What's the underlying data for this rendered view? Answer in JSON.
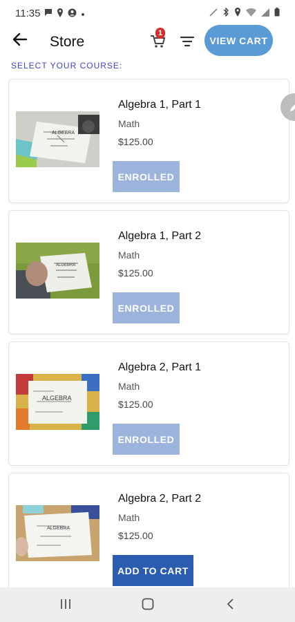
{
  "status_bar": {
    "time": "11:35",
    "left_icons": [
      "message-icon",
      "location-icon",
      "account-icon",
      "dot-icon"
    ],
    "right_icons": [
      "mute-icon",
      "bluetooth-icon",
      "location-icon",
      "wifi-icon",
      "signal-icon",
      "battery-icon"
    ]
  },
  "app_bar": {
    "title": "Store",
    "cart_badge": "1",
    "view_cart_label": "VIEW CART",
    "accent": "#5b9bd5"
  },
  "content": {
    "select_label": "SELECT YOUR COURSE:",
    "courses": [
      {
        "name": "Algebra 1, Part 1",
        "subject": "Math",
        "price": "$125.00",
        "button": "ENROLLED",
        "status": "enrolled"
      },
      {
        "name": "Algebra 1, Part 2",
        "subject": "Math",
        "price": "$125.00",
        "button": "ENROLLED",
        "status": "enrolled"
      },
      {
        "name": "Algebra 2, Part 1",
        "subject": "Math",
        "price": "$125.00",
        "button": "ENROLLED",
        "status": "enrolled"
      },
      {
        "name": "Algebra 2, Part 2",
        "subject": "Math",
        "price": "$125.00",
        "button": "ADD TO CART",
        "status": "available"
      }
    ]
  },
  "colors": {
    "enrolled_button": "#9cb4dc",
    "add_button": "#2a5db0",
    "label_blue": "#3b43c9",
    "badge_red": "#d32f2f"
  },
  "nav_bar": {
    "icons": [
      "recent-apps-icon",
      "home-icon",
      "back-icon"
    ]
  }
}
